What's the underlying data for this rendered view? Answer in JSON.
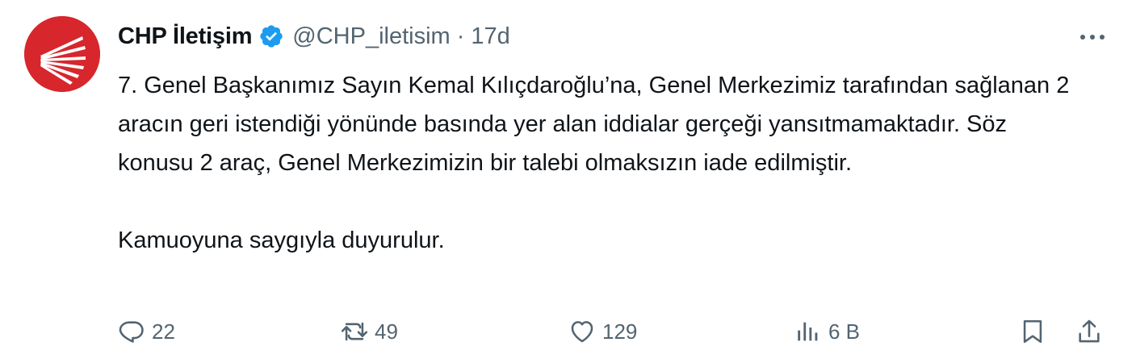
{
  "author": {
    "display_name": "CHP İletişim",
    "handle": "@CHP_iletisim",
    "separator": "·",
    "time": "17d",
    "verified": true,
    "avatar_color": "#d7262c"
  },
  "tweet": {
    "paragraphs": [
      "7. Genel Başkanımız Sayın Kemal Kılıçdaroğlu’na, Genel Merkezimiz tarafından sağlanan 2 aracın geri istendiği yönünde basında yer alan iddialar gerçeği yansıtmamaktadır.  Söz konusu 2 araç, Genel Merkezimizin bir talebi olmaksızın iade edilmiştir.",
      "Kamuoyuna saygıyla duyurulur."
    ]
  },
  "actions": {
    "reply": {
      "icon": "reply-icon",
      "count": "22"
    },
    "retweet": {
      "icon": "retweet-icon",
      "count": "49"
    },
    "like": {
      "icon": "heart-icon",
      "count": "129"
    },
    "views": {
      "icon": "views-icon",
      "count": "6 B"
    },
    "bookmark": {
      "icon": "bookmark-icon"
    },
    "share": {
      "icon": "share-icon"
    }
  },
  "colors": {
    "text": "#0f1419",
    "secondary": "#536471",
    "verified_blue": "#1d9bf0"
  }
}
